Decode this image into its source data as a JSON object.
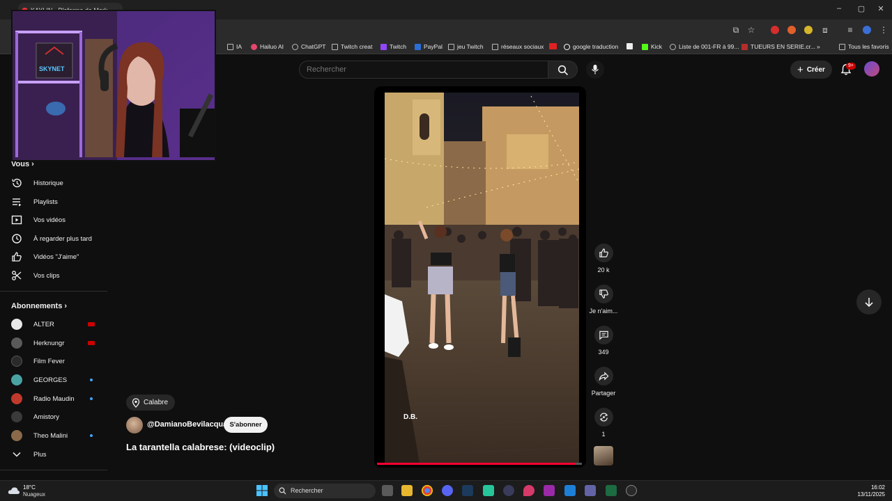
{
  "browser": {
    "tab_title": "KAYLIN · Plaforme de Mark",
    "bookmarks": [
      {
        "label": "IA",
        "icon": "folder-icon"
      },
      {
        "label": "Hailuo AI",
        "icon": "hailuo-icon"
      },
      {
        "label": "ChatGPT",
        "icon": "chatgpt-icon"
      },
      {
        "label": "Twitch creat",
        "icon": "folder-icon"
      },
      {
        "label": "Twitch",
        "icon": "twitch-icon"
      },
      {
        "label": "PayPal",
        "icon": "paypal-icon"
      },
      {
        "label": "jeu Twitch",
        "icon": "folder-icon"
      },
      {
        "label": "réseaux sociaux",
        "icon": "folder-icon"
      },
      {
        "label": "google traduction",
        "icon": "google-icon"
      },
      {
        "label": "Kick",
        "icon": "kick-icon"
      },
      {
        "label": "Liste de 001-FR à 99...",
        "icon": "globe-icon"
      },
      {
        "label": "TUEURS EN SERIE.cr...",
        "icon": "site-icon"
      }
    ],
    "all_bookmarks_label": "Tous les favoris"
  },
  "header": {
    "search_placeholder": "Rechercher",
    "create_label": "Créer",
    "notifications_badge": "9+"
  },
  "sidebar": {
    "you_label": "Vous",
    "you_items": [
      {
        "label": "Historique",
        "icon": "history-icon"
      },
      {
        "label": "Playlists",
        "icon": "playlists-icon"
      },
      {
        "label": "Vos vidéos",
        "icon": "your-videos-icon"
      },
      {
        "label": "À regarder plus tard",
        "icon": "watch-later-icon"
      },
      {
        "label": "Vidéos \"J'aime\"",
        "icon": "liked-videos-icon"
      },
      {
        "label": "Vos clips",
        "icon": "clips-icon"
      }
    ],
    "subscriptions_label": "Abonnements",
    "subscriptions": [
      {
        "name": "ALTER",
        "status": "live",
        "color": "#e8e8e8"
      },
      {
        "name": "Herknungr",
        "status": "live",
        "color": "#5a5a5a"
      },
      {
        "name": "Film Fever",
        "status": "none",
        "color": "#2a2a2a"
      },
      {
        "name": "GEORGES",
        "status": "new",
        "color": "#4aa3a3"
      },
      {
        "name": "Radio Maudin",
        "status": "new",
        "color": "#c0392b"
      },
      {
        "name": "Amistory",
        "status": "none",
        "color": "#3a3a3a"
      },
      {
        "name": "Theo Malini",
        "status": "new",
        "color": "#8a6a4a"
      }
    ],
    "more_label": "Plus"
  },
  "short": {
    "location": "Calabre",
    "channel": "@DamianoBevilacqua",
    "subscribe_label": "S'abonner",
    "title": "La tarantella calabrese: (videoclip)",
    "watermark": "D.B.",
    "progress_percent": 97,
    "actions": {
      "likes": "20 k",
      "dislike_label": "Je n'aim...",
      "comments": "349",
      "share_label": "Partager",
      "remix_count": "1"
    }
  },
  "webcam": {
    "sign_text": "SKYNET"
  },
  "taskbar": {
    "temperature": "18°C",
    "weather": "Nuageux",
    "search_label": "Rechercher",
    "time": "16:02",
    "date": "13/11/2025"
  },
  "colors": {
    "background": "#0f0f0f",
    "accent_red": "#ff0033",
    "live_red": "#cc0000",
    "new_dot_blue": "#3ea6ff"
  }
}
